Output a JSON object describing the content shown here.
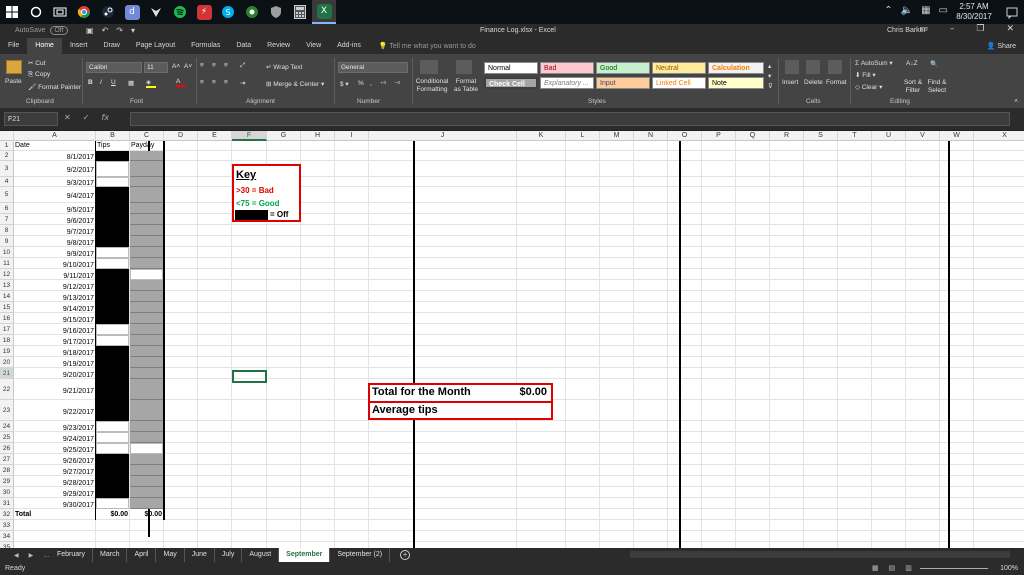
{
  "taskbar": {
    "icons": [
      "windows-start-icon",
      "cortana-circle-icon",
      "task-view-icon",
      "chrome-icon",
      "steam-icon",
      "discord-icon",
      "app-icon",
      "spotify-icon",
      "app-red-icon",
      "skype-icon",
      "app-green-icon",
      "app-shield-icon",
      "calculator-icon",
      "excel-taskbar-icon"
    ],
    "clock_time": "2:57 AM",
    "clock_date": "8/30/2017"
  },
  "titlebar": {
    "autosave_label": "AutoSave",
    "autosave_state": "Off",
    "title": "Finance Log.xlsx - Excel",
    "user": "Chris Barker"
  },
  "ribbon_tabs": [
    "File",
    "Home",
    "Insert",
    "Draw",
    "Page Layout",
    "Formulas",
    "Data",
    "Review",
    "View",
    "Add-ins"
  ],
  "active_ribbon_tab": "Home",
  "tell_me": "Tell me what you want to do",
  "share_label": "Share",
  "ribbon": {
    "paste": "Paste",
    "cut": "Cut",
    "copy": "Copy",
    "format_painter": "Format Painter",
    "clipboard_label": "Clipboard",
    "font_name": "Calibri",
    "font_size": "11",
    "font_label": "Font",
    "wrap_text": "Wrap Text",
    "merge_center": "Merge & Center",
    "alignment_label": "Alignment",
    "number_format": "General",
    "number_label": "Number",
    "conditional_formatting": "Conditional Formatting",
    "format_as_table": "Format as Table",
    "styles_label": "Styles",
    "styles": {
      "normal": "Normal",
      "bad": "Bad",
      "good": "Good",
      "neutral": "Neutral",
      "calculation": "Calculation",
      "check_cell": "Check Cell",
      "explanatory": "Explanatory ...",
      "input": "Input",
      "linked_cell": "Linked Cell",
      "note": "Note"
    },
    "insert": "Insert",
    "delete": "Delete",
    "format": "Format",
    "cells_label": "Cells",
    "autosum": "AutoSum",
    "fill": "Fill",
    "clear": "Clear",
    "sort_filter": "Sort & Filter",
    "find_select": "Find & Select",
    "editing_label": "Editing"
  },
  "formula_bar": {
    "name_box": "F21",
    "content": ""
  },
  "columns": [
    "A",
    "B",
    "C",
    "D",
    "E",
    "F",
    "G",
    "H",
    "I",
    "J",
    "K",
    "L",
    "M",
    "N",
    "O",
    "P",
    "Q",
    "R",
    "S",
    "T",
    "U",
    "V",
    "W",
    "X"
  ],
  "selected_column": "F",
  "selected_row": "21",
  "sheet": {
    "header_date": "Date",
    "header_tips": "Tips",
    "header_payday": "Payday",
    "dates": [
      "8/1/2017",
      "9/2/2017",
      "9/3/2017",
      "9/4/2017",
      "9/5/2017",
      "9/6/2017",
      "9/7/2017",
      "9/8/2017",
      "9/9/2017",
      "9/10/2017",
      "9/11/2017",
      "9/12/2017",
      "9/13/2017",
      "9/14/2017",
      "9/15/2017",
      "9/16/2017",
      "9/17/2017",
      "9/18/2017",
      "9/19/2017",
      "9/20/2017",
      "9/21/2017",
      "9/22/2017",
      "9/23/2017",
      "9/24/2017",
      "9/25/2017",
      "9/26/2017",
      "9/27/2017",
      "9/28/2017",
      "9/29/2017",
      "9/30/2017"
    ],
    "total_label": "Total",
    "total_tips": "$0.00",
    "total_payday": "$0.00"
  },
  "key": {
    "title": "Key",
    "bad": ">30 = Bad",
    "good": "<75 = Good",
    "off": "= Off",
    "bad_color": "#e00000",
    "good_color": "#00a550"
  },
  "totals_box": {
    "total_label": "Total for the Month",
    "total_value": "$0.00",
    "average_label": "Average tips"
  },
  "sheet_tabs": [
    "February",
    "March",
    "April",
    "May",
    "June",
    "July",
    "August",
    "September",
    "September (2)"
  ],
  "active_sheet": "September",
  "status": {
    "ready": "Ready",
    "zoom": "100%"
  },
  "colors": {
    "excel_green": "#217346",
    "dark_bg": "#2b2b2b",
    "ribbon_bg": "#444444"
  }
}
